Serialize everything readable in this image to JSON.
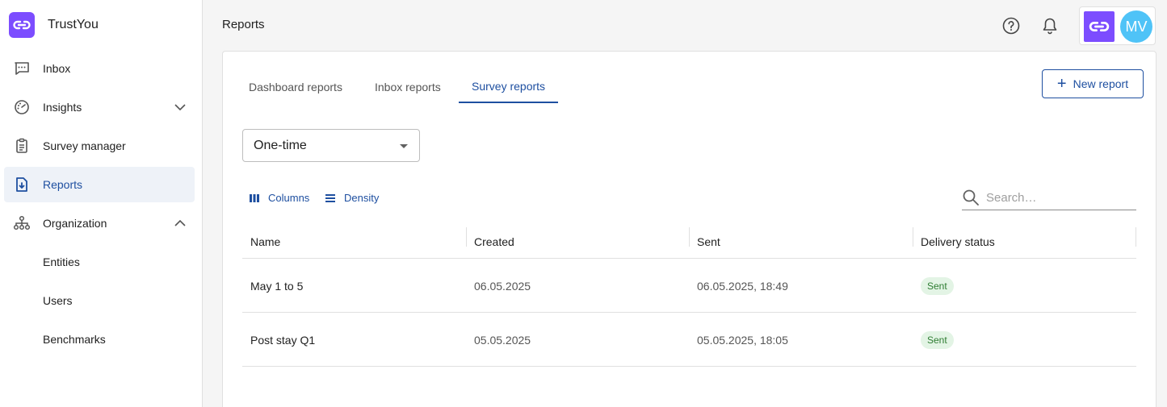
{
  "brand": {
    "name": "TrustYou",
    "logo_icon": "link-icon",
    "accent": "#7c4dff"
  },
  "sidebar": {
    "items": [
      {
        "label": "Inbox",
        "icon": "chat-icon"
      },
      {
        "label": "Insights",
        "icon": "gauge-icon",
        "chevron": "down"
      },
      {
        "label": "Survey manager",
        "icon": "clipboard-icon"
      },
      {
        "label": "Reports",
        "icon": "report-download-icon",
        "active": true
      },
      {
        "label": "Organization",
        "icon": "org-chart-icon",
        "chevron": "up"
      },
      {
        "label": "Entities"
      },
      {
        "label": "Users"
      },
      {
        "label": "Benchmarks"
      }
    ]
  },
  "header": {
    "title": "Reports",
    "help_icon": "help-icon",
    "bell_icon": "bell-icon",
    "avatar_initials": "MV",
    "avatar_color": "#4fc3f7"
  },
  "tabs": [
    {
      "label": "Dashboard reports"
    },
    {
      "label": "Inbox reports"
    },
    {
      "label": "Survey reports",
      "active": true
    }
  ],
  "new_report_label": "New report",
  "frequency_select": {
    "value": "One-time"
  },
  "toolbar": {
    "columns_label": "Columns",
    "density_label": "Density"
  },
  "search": {
    "placeholder": "Search…"
  },
  "table": {
    "columns": [
      "Name",
      "Created",
      "Sent",
      "Delivery status"
    ],
    "rows": [
      {
        "name": "May 1 to 5",
        "created": "06.05.2025",
        "sent": "06.05.2025, 18:49",
        "status": "Sent"
      },
      {
        "name": "Post stay Q1",
        "created": "05.05.2025",
        "sent": "05.05.2025, 18:05",
        "status": "Sent"
      }
    ]
  },
  "colors": {
    "primary": "#1e4fa0",
    "active_bg": "#eef2f8",
    "status_sent_bg": "#e3f4e5",
    "status_sent_fg": "#2e7d32"
  }
}
